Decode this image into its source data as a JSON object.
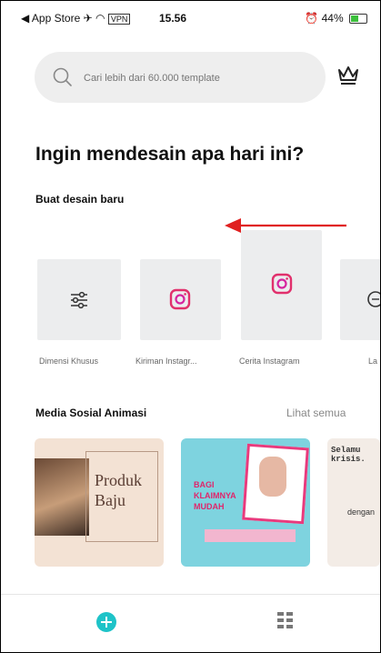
{
  "status_bar": {
    "back_app": "◀ App Store",
    "time": "15.56",
    "battery_text": "44%"
  },
  "search": {
    "placeholder": "Cari lebih dari 60.000 template"
  },
  "headline": "Ingin mendesain apa hari ini?",
  "create_section": {
    "title": "Buat desain baru",
    "items": [
      {
        "label": "Dimensi Khusus",
        "icon": "sliders-icon"
      },
      {
        "label": "Kiriman Instagr...",
        "icon": "instagram-icon"
      },
      {
        "label": "Cerita Instagram",
        "icon": "instagram-icon"
      },
      {
        "label": "La",
        "icon": "partial-icon"
      }
    ]
  },
  "animated_section": {
    "title": "Media Sosial Animasi",
    "see_all": "Lihat semua",
    "templates": [
      {
        "text_line1": "Produk",
        "text_line2": "Baju"
      },
      {
        "text_line1": "BAGI",
        "text_line2": "KLAIMNYA",
        "text_line3": "MUDAH"
      },
      {
        "text_line1": "Selamu",
        "text_line2": "krisis.",
        "text_line3": "dengan"
      }
    ]
  },
  "colors": {
    "accent": "#1ec3c8",
    "instagram": "#e1306c",
    "arrow": "#e02020"
  }
}
